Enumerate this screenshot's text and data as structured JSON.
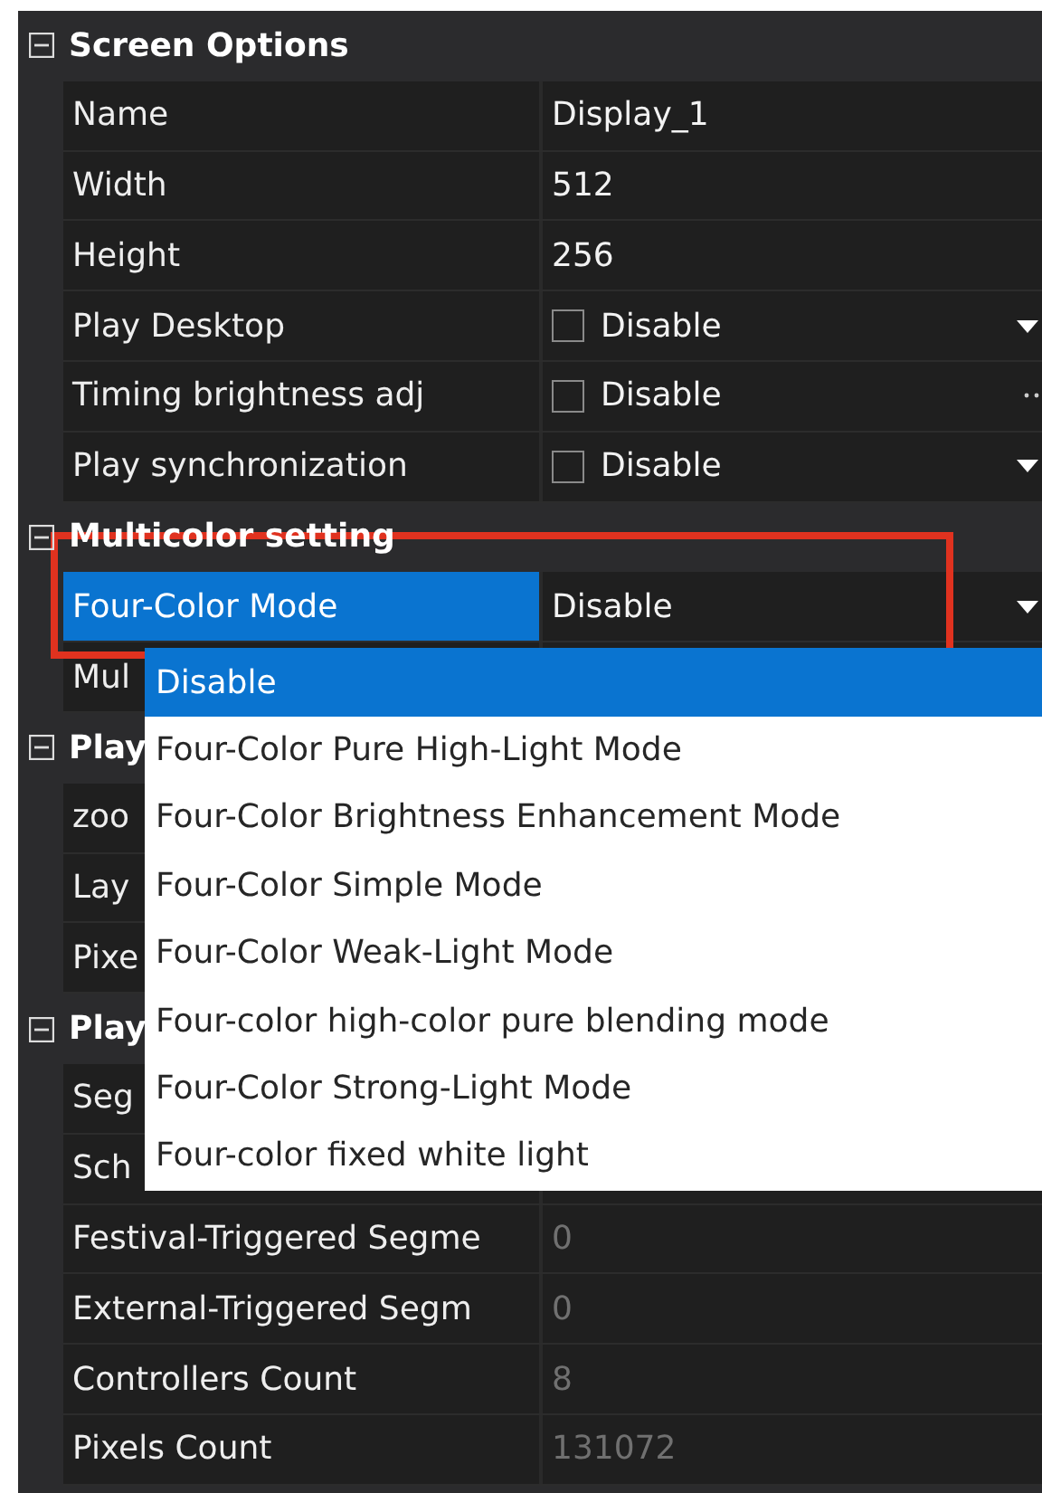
{
  "sections": [
    {
      "title": "Screen Options",
      "expanded": true,
      "rows": [
        {
          "label": "Name",
          "kind": "text",
          "value": "Display_1",
          "selected": false
        },
        {
          "label": "Width",
          "kind": "text",
          "value": "512",
          "selected": false
        },
        {
          "label": "Height",
          "kind": "text",
          "value": "256",
          "selected": false
        },
        {
          "label": "Play Desktop",
          "kind": "checkbox",
          "value": "Disable",
          "checked": false,
          "button": {
            "kind": "dropdown"
          },
          "selected": false
        },
        {
          "label": "Timing brightness adj",
          "kind": "checkbox",
          "value": "Disable",
          "checked": false,
          "button": {
            "kind": "ellipsis"
          },
          "selected": false
        },
        {
          "label": "Play synchronization",
          "kind": "checkbox",
          "value": "Disable",
          "checked": false,
          "button": {
            "kind": "dropdown"
          },
          "selected": false
        }
      ]
    },
    {
      "title": "Multicolor setting",
      "expanded": true,
      "rows": [
        {
          "label": "Four-Color Mode",
          "kind": "text",
          "value": "Disable",
          "button": {
            "kind": "dropdown"
          },
          "selected": true,
          "annotated": true,
          "dropdown": {
            "options": [
              {
                "label": "Disable",
                "selected": true
              },
              {
                "label": "Four-Color Pure High-Light Mode",
                "selected": false
              },
              {
                "label": "Four-Color Brightness Enhancement Mode",
                "selected": false
              },
              {
                "label": "Four-Color Simple Mode",
                "selected": false
              },
              {
                "label": "Four-Color Weak-Light Mode",
                "selected": false
              },
              {
                "label": "Four-color high-color pure blending mode",
                "selected": false
              },
              {
                "label": "Four-Color Strong-Light Mode",
                "selected": false
              },
              {
                "label": "Four-color fixed white light",
                "selected": false
              }
            ]
          }
        },
        {
          "label": "Mul",
          "kind": "text",
          "selected": false
        }
      ]
    },
    {
      "title": "Play",
      "expanded": true,
      "rows": [
        {
          "label": "zoo",
          "kind": "text",
          "selected": false
        },
        {
          "label": "Lay",
          "kind": "text",
          "selected": false
        },
        {
          "label": "Pixe",
          "kind": "text",
          "selected": false
        }
      ]
    },
    {
      "title": "Play",
      "expanded": true,
      "rows": [
        {
          "label": "Seg",
          "kind": "text",
          "selected": false
        },
        {
          "label": "Sch",
          "kind": "text",
          "selected": false
        },
        {
          "label": "Festival-Triggered Segme",
          "kind": "text",
          "value": "0",
          "readonly": true,
          "selected": false
        },
        {
          "label": "External-Triggered Segm",
          "kind": "text",
          "value": "0",
          "readonly": true,
          "selected": false
        },
        {
          "label": "Controllers Count",
          "kind": "text",
          "value": "8",
          "readonly": true,
          "selected": false
        },
        {
          "label": "Pixels Count",
          "kind": "text",
          "value": "131072",
          "readonly": true,
          "selected": false
        }
      ]
    }
  ]
}
